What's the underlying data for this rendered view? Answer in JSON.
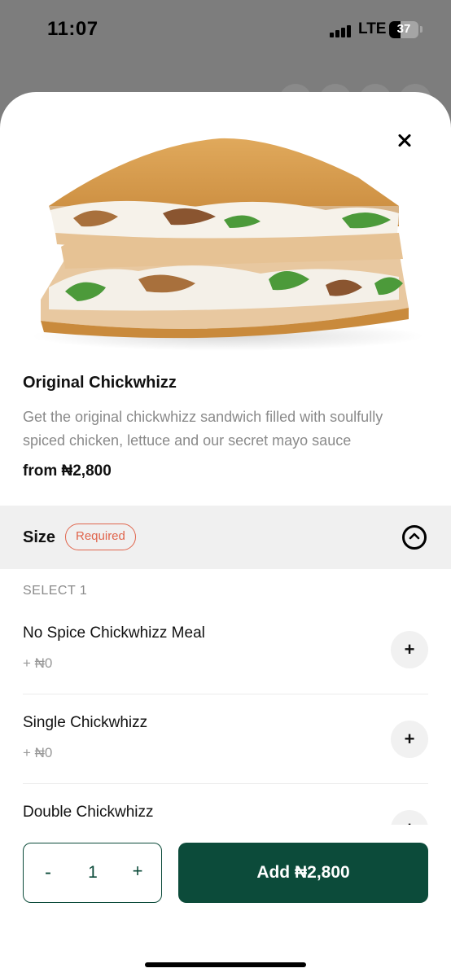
{
  "status_bar": {
    "time": "11:07",
    "network": "LTE",
    "battery": "37"
  },
  "product": {
    "title": "Original Chickwhizz",
    "description": "Get the original chickwhizz sandwich filled with soulfully spiced chicken, lettuce and our secret mayo sauce",
    "price_from": "from ₦2,800",
    "image_icon": "sandwich-image"
  },
  "size_section": {
    "label": "Size",
    "badge": "Required",
    "select_hint": "SELECT 1",
    "options": [
      {
        "name": "No Spice Chickwhizz Meal",
        "price": "+ ₦0"
      },
      {
        "name": "Single Chickwhizz",
        "price": "+ ₦0"
      },
      {
        "name": "Double Chickwhizz",
        "price": ""
      }
    ]
  },
  "cart": {
    "minus": "-",
    "quantity": "1",
    "plus": "+",
    "add_label": "Add ₦2,800"
  },
  "colors": {
    "brand_green": "#0c4b3a",
    "required_red": "#e0654c"
  }
}
